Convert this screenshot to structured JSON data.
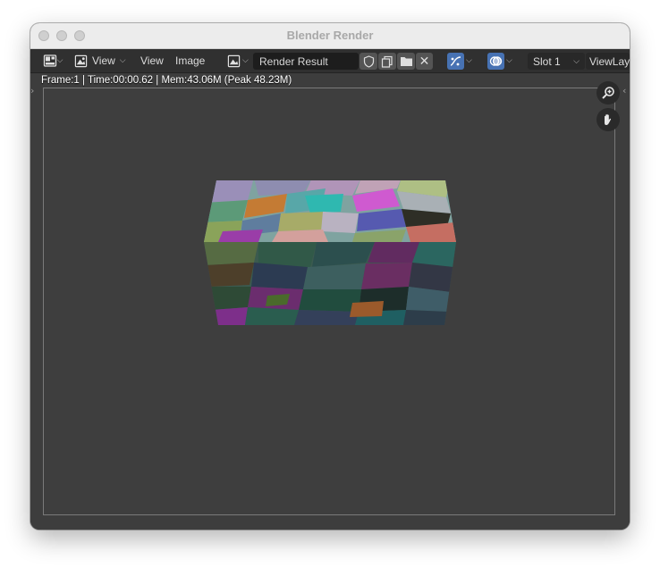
{
  "window": {
    "title": "Blender Render"
  },
  "header": {
    "editor_type_icon": "image-editor-icon",
    "view_mode_icon": "view-mode-icon",
    "view_mode_label": "View",
    "menu": [
      "View",
      "Image"
    ],
    "image_browse_icon": "image-browse-icon",
    "image_name": "Render Result",
    "slot_label": "Slot 1",
    "view_layer_label": "ViewLayer"
  },
  "viewport": {
    "stats_text": "Frame:1 | Time:00:00.62 | Mem:43.06M (Peak 48.23M)"
  },
  "colors": {
    "header_bg": "#303030",
    "viewport_bg": "#3d3d3d",
    "active_toggle": "#4772b3"
  }
}
